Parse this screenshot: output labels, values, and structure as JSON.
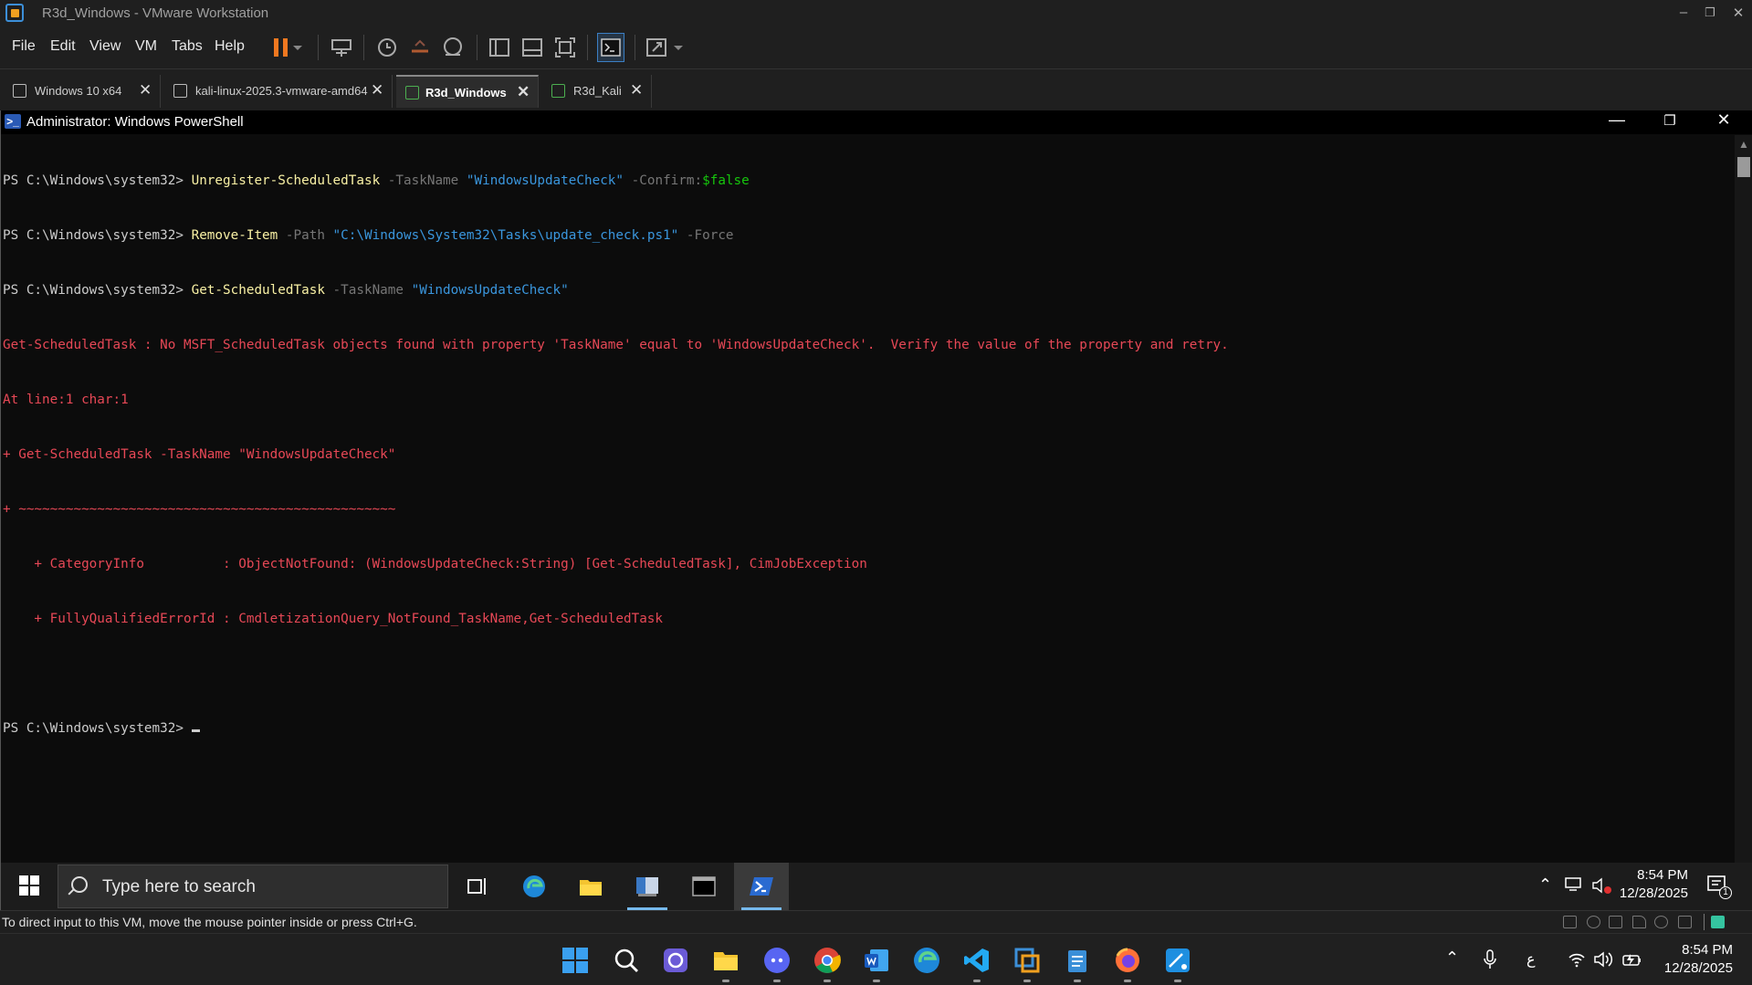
{
  "vmware": {
    "window_title": "R3d_Windows - VMware Workstation",
    "window_controls": {
      "minimize": "–",
      "restore": "❐",
      "close": "✕"
    },
    "menu": [
      "File",
      "Edit",
      "View",
      "VM",
      "Tabs",
      "Help"
    ],
    "toolbar_icons": [
      "pause-icon",
      "dropdown-arrow-icon",
      "send-keys-icon",
      "snapshot-icon",
      "revert-snapshot-icon",
      "snapshot-manager-icon",
      "library-icon",
      "thumbnail-bar-icon",
      "full-screen-icon",
      "console-view-icon",
      "stretch-guest-icon",
      "dropdown-arrow-icon"
    ],
    "tabs": [
      {
        "label": "Windows 10 x64",
        "active": false
      },
      {
        "label": "kali-linux-2025.3-vmware-amd64",
        "active": false
      },
      {
        "label": "R3d_Windows",
        "active": true
      },
      {
        "label": "R3d_Kali",
        "active": false
      }
    ],
    "tab_close_glyph": "✕",
    "status_message": "To direct input to this VM, move the mouse pointer inside or press Ctrl+G.",
    "status_device_icons": [
      "hard-disk-icon",
      "cd-dvd-icon",
      "network-adapter-icon",
      "usb-controller-icon",
      "sound-card-icon",
      "printer-icon",
      "display-icon"
    ]
  },
  "powershell": {
    "title": "Administrator: Windows PowerShell",
    "icon_glyph": ">_",
    "controls": {
      "minimize": "—",
      "maximize": "❐",
      "close": "✕"
    },
    "lines": {
      "l1": {
        "prompt": "PS C:\\Windows\\system32> ",
        "cmd": "Unregister-ScheduledTask",
        "p1": " -TaskName ",
        "s1": "\"WindowsUpdateCheck\"",
        "p2": " -Confirm:",
        "v1": "$false"
      },
      "l2": {
        "prompt": "PS C:\\Windows\\system32> ",
        "cmd": "Remove-Item",
        "p1": " -Path ",
        "s1": "\"C:\\Windows\\System32\\Tasks\\update_check.ps1\"",
        "p2": " -Force"
      },
      "l3": {
        "prompt": "PS C:\\Windows\\system32> ",
        "cmd": "Get-ScheduledTask",
        "p1": " -TaskName ",
        "s1": "\"WindowsUpdateCheck\""
      },
      "e1": "Get-ScheduledTask : No MSFT_ScheduledTask objects found with property 'TaskName' equal to 'WindowsUpdateCheck'.  Verify the value of the property and retry.",
      "e2": "At line:1 char:1",
      "e3": "+ Get-ScheduledTask -TaskName \"WindowsUpdateCheck\"",
      "e4": "+ ~~~~~~~~~~~~~~~~~~~~~~~~~~~~~~~~~~~~~~~~~~~~~~~~",
      "e5": "    + CategoryInfo          : ObjectNotFound: (WindowsUpdateCheck:String) [Get-ScheduledTask], CimJobException",
      "e6": "    + FullyQualifiedErrorId : CmdletizationQuery_NotFound_TaskName,Get-ScheduledTask",
      "current_prompt": "PS C:\\Windows\\system32> "
    },
    "scroll_up": "▲",
    "scroll_down": "▼"
  },
  "guest_taskbar": {
    "search_placeholder": "Type here to search",
    "apps": [
      "task-view-icon",
      "edge-icon",
      "file-explorer-icon",
      "server-manager-icon",
      "command-prompt-icon",
      "powershell-icon"
    ],
    "active_app": "powershell-icon",
    "tray": {
      "chevron": "⌃",
      "time": "8:54 PM",
      "date": "12/28/2025",
      "notifications_count": "1"
    }
  },
  "host_taskbar": {
    "apps": [
      "windows-start-icon",
      "search-icon",
      "copilot-icon",
      "file-explorer-icon",
      "discord-icon",
      "chrome-icon",
      "word-icon",
      "edge-icon",
      "vscode-icon",
      "vmware-icon",
      "notepad-icon",
      "firefox-icon",
      "snipping-tool-icon"
    ],
    "tray": {
      "chevron": "⌃",
      "language": "ع",
      "time": "8:54 PM",
      "date": "12/28/2025"
    }
  },
  "colors": {
    "console_bg": "#0c0c0c",
    "console_text": "#cccccc",
    "cmdlet": "#f9f1a5",
    "parameter": "#767676",
    "string": "#3a96dd",
    "variable": "#16c60c",
    "error": "#e74856",
    "pause_orange": "#f07820"
  }
}
